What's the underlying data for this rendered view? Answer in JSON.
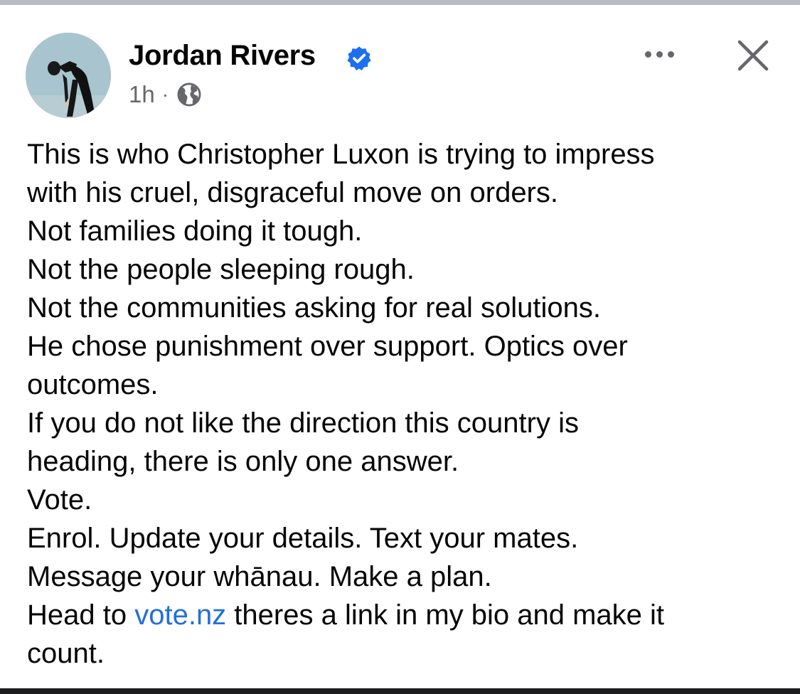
{
  "post": {
    "author_name": "Jordan Rivers",
    "timestamp": "1h",
    "separator": "·",
    "audience_icon": "globe-icon",
    "verified_icon": "verified-badge-icon",
    "menu_icon": "more-horizontal-icon",
    "close_icon": "close-icon",
    "body": {
      "line_1": "This is who Christopher Luxon is trying to impress",
      "line_2": "with his cruel, disgraceful move on orders.",
      "line_3": "Not families doing it tough.",
      "line_4": "Not the people sleeping rough.",
      "line_5": "Not the communities asking for real solutions.",
      "line_6": "He chose punishment over support. Optics over",
      "line_7": "outcomes.",
      "line_8": "If you do not like the direction this country is",
      "line_9": "heading, there is only one answer.",
      "line_10": "Vote.",
      "line_11": "Enrol. Update your details. Text your mates.",
      "line_12": "Message your whānau. Make a plan.",
      "line_13_before": "Head to ",
      "line_13_link": "vote.nz",
      "line_13_after": " theres a link in my bio and make it",
      "line_14": "count."
    }
  },
  "colors": {
    "link": "#216fdb",
    "verified": "#1d6ff2",
    "meta_text": "#65676b",
    "body_text": "#050505"
  }
}
